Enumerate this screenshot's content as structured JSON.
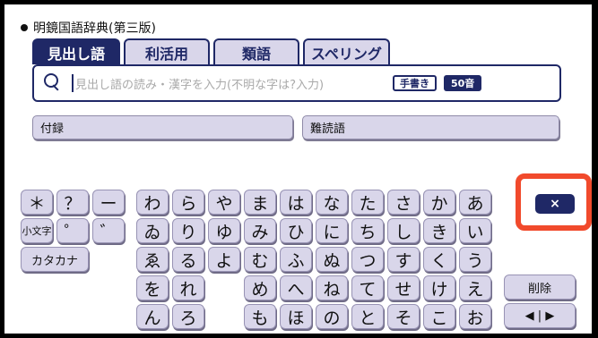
{
  "app": {
    "title": "明鏡国語辞典(第三版)"
  },
  "tabs": [
    {
      "label": "見出し語"
    },
    {
      "label": "利活用"
    },
    {
      "label": "類語"
    },
    {
      "label": "スペリング"
    }
  ],
  "search": {
    "placeholder": "見出し語の読み・漢字を入力(不明な字は?入力)",
    "handwriting_label": "手書き",
    "kana_label": "50音"
  },
  "sub_buttons": [
    {
      "label": "付録"
    },
    {
      "label": "難読語"
    }
  ],
  "left_keys": {
    "asterisk": "＊",
    "question": "？",
    "long_dash": "ー",
    "kogaki": "小文字",
    "dakuten": "゛",
    "handakuten": "゜",
    "katakana": "カタカナ"
  },
  "kana_rows": [
    [
      "わ",
      "ら",
      "や",
      "ま",
      "は",
      "な",
      "た",
      "さ",
      "か",
      "あ"
    ],
    [
      "ゐ",
      "り",
      "ゆ",
      "み",
      "ひ",
      "に",
      "ち",
      "し",
      "き",
      "い"
    ],
    [
      "ゑ",
      "る",
      "よ",
      "む",
      "ふ",
      "ぬ",
      "つ",
      "す",
      "く",
      "う"
    ],
    [
      "を",
      "れ",
      "",
      "め",
      "へ",
      "ね",
      "て",
      "せ",
      "け",
      "え"
    ],
    [
      "ん",
      "ろ",
      "",
      "も",
      "ほ",
      "の",
      "と",
      "そ",
      "こ",
      "お"
    ]
  ],
  "right_keys": {
    "close": "×",
    "delete": "削除",
    "cursor": "◀ | ▶"
  },
  "colors": {
    "accent": "#1f2866",
    "key_bg": "#d9d6ea",
    "highlight": "#f14a2c"
  }
}
